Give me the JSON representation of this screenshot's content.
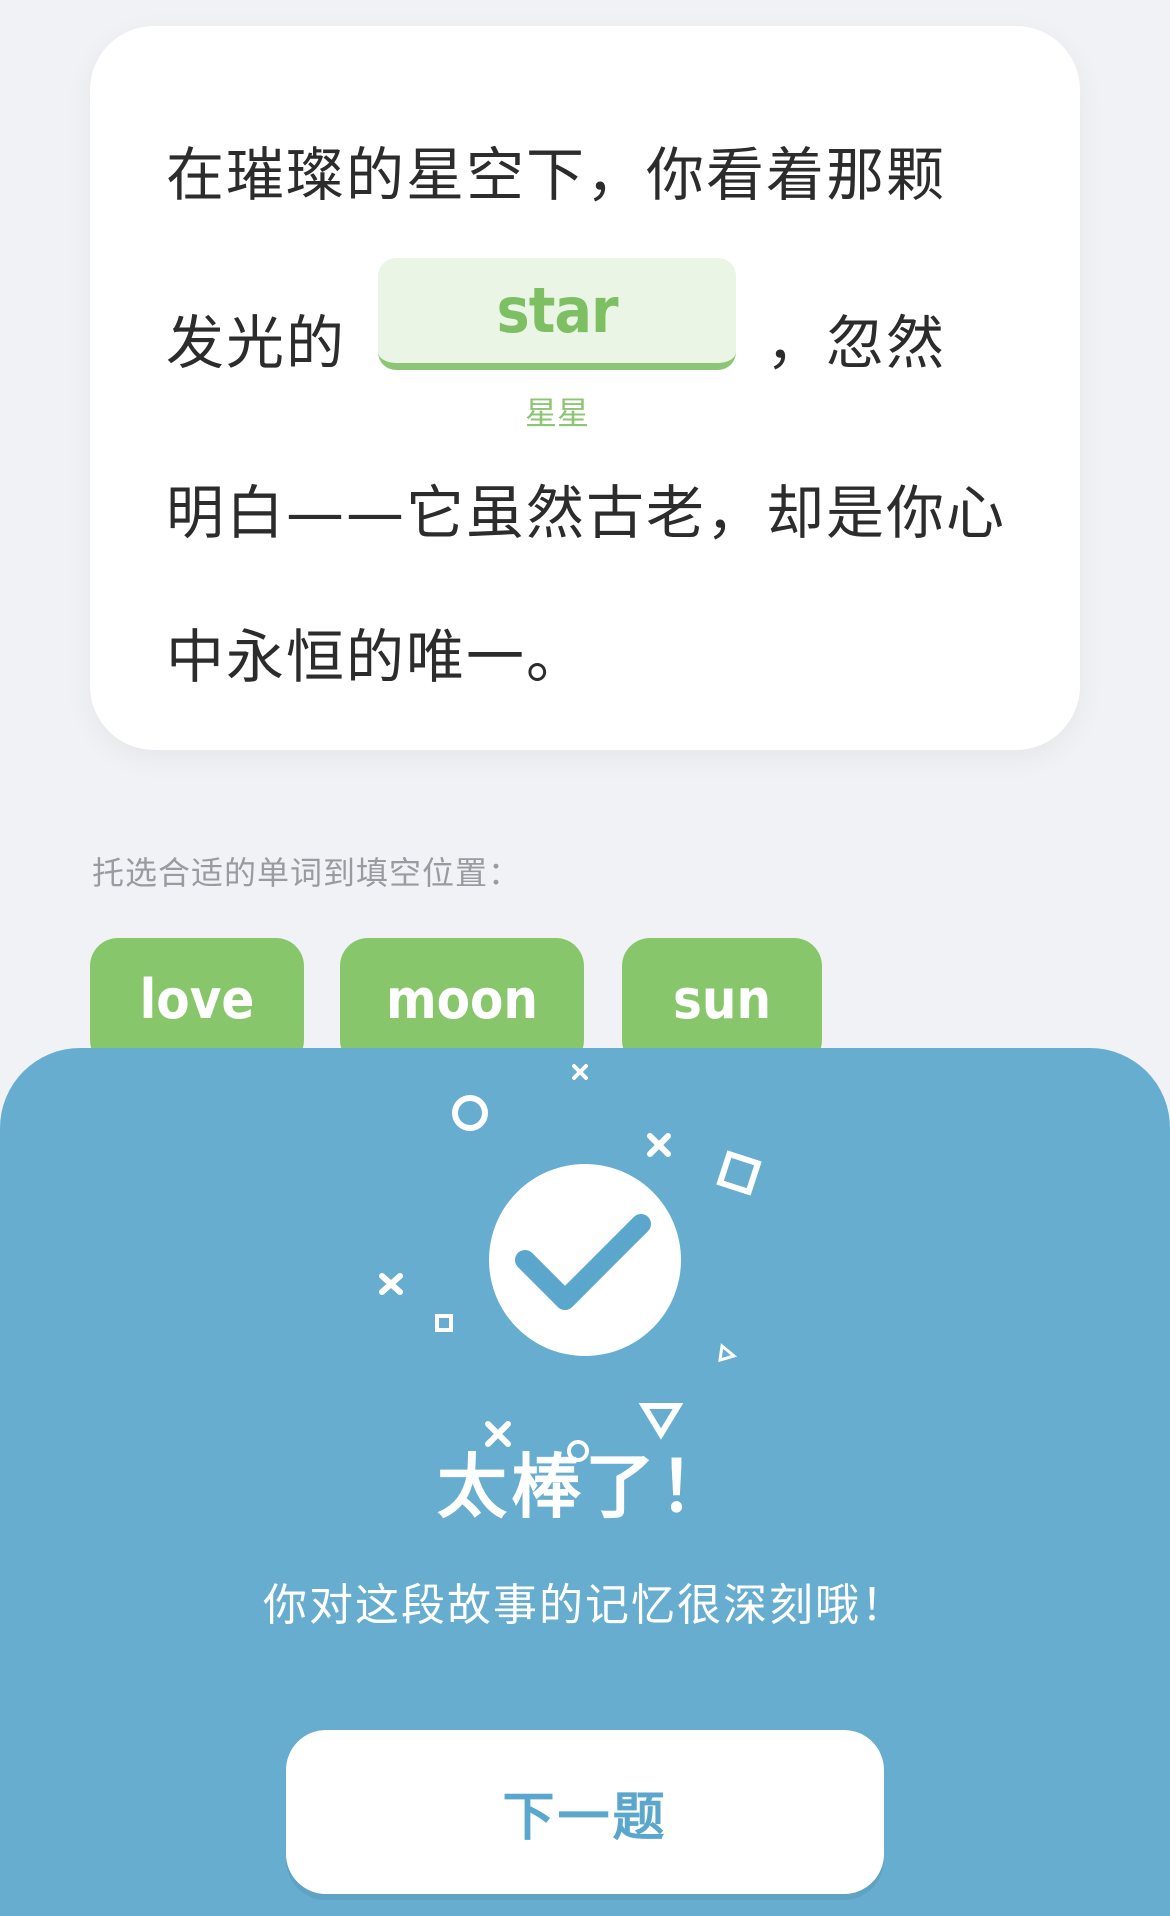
{
  "story": {
    "line1": "在璀璨的星空下，你看着那颗",
    "line2_before": "发光的",
    "line2_after": "，忽然",
    "line3": "明白——它虽然古老，却是你心",
    "line4": "中永恒的唯一。",
    "blank_answer": "star",
    "blank_translation": "星星"
  },
  "instruction": "托选合适的单词到填空位置：",
  "choices": [
    "love",
    "moon",
    "sun"
  ],
  "result": {
    "title": "太棒了！",
    "message": "你对这段故事的记忆很深刻哦！",
    "next_button": "下一题"
  },
  "colors": {
    "accent_green": "#88c66c",
    "panel_blue": "#66adcf",
    "button_text_blue": "#5ba6cc"
  },
  "icons": {
    "check": "check-icon",
    "confetti": "confetti-decoration"
  }
}
